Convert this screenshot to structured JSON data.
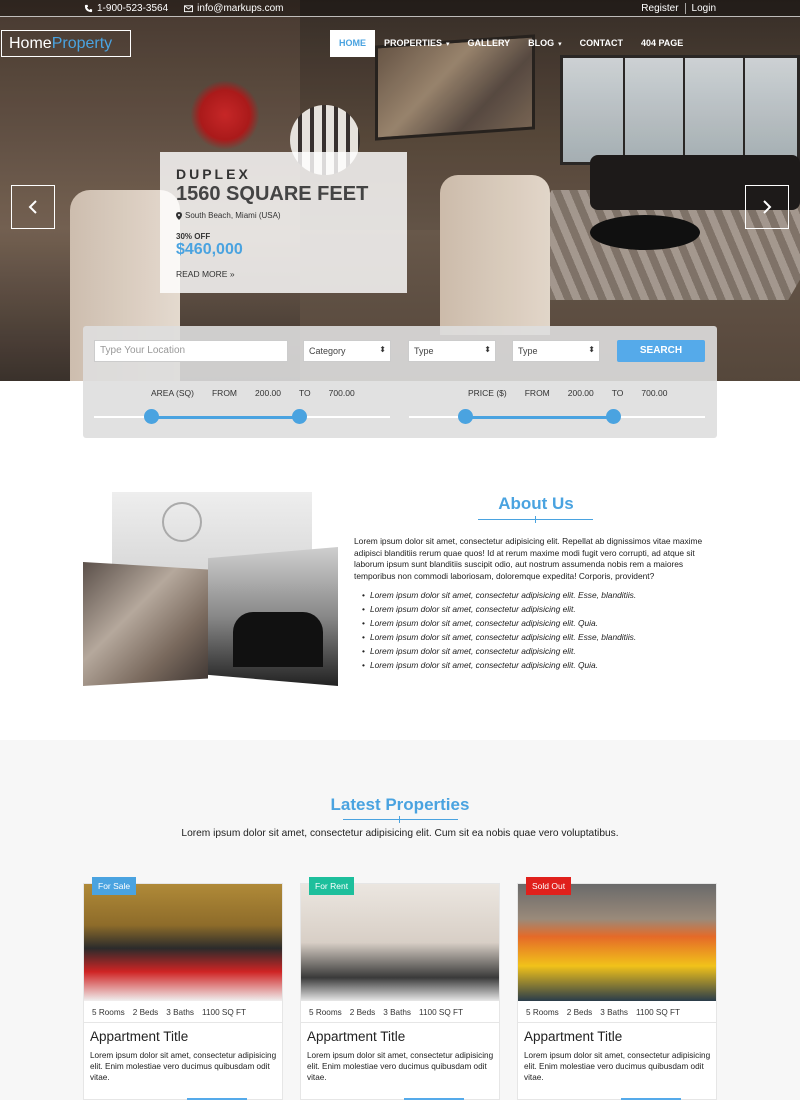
{
  "topbar": {
    "phone": "1-900-523-3564",
    "email": "info@markups.com",
    "register": "Register",
    "login": "Login"
  },
  "logo": {
    "part1": "Home",
    "part2": "Property"
  },
  "nav": {
    "items": [
      "HOME",
      "PROPERTIES",
      "GALLERY",
      "BLOG",
      "CONTACT",
      "404 PAGE"
    ]
  },
  "slide": {
    "type": "DUPLEX",
    "size": "1560 SQUARE FEET",
    "location": "South Beach, Miami (USA)",
    "discount": "30% OFF",
    "price": "$460,000",
    "more": "READ MORE"
  },
  "search": {
    "location_placeholder": "Type Your Location",
    "category": "Category",
    "type1": "Type",
    "type2": "Type",
    "button": "SEARCH",
    "area": {
      "label": "AREA (SQ)",
      "from_label": "FROM",
      "from": "200.00",
      "to_label": "TO",
      "to": "700.00"
    },
    "price": {
      "label": "PRICE ($)",
      "from_label": "FROM",
      "from": "200.00",
      "to_label": "TO",
      "to": "700.00"
    }
  },
  "about": {
    "title": "About Us",
    "text": "Lorem ipsum dolor sit amet, consectetur adipisicing elit. Repellat ab dignissimos vitae maxime adipisci blanditiis rerum quae quos! Id at rerum maxime modi fugit vero corrupti, ad atque sit laborum ipsum sunt blanditiis suscipit odio, aut nostrum assumenda nobis rem a maiores temporibus non commodi laboriosam, doloremque expedita! Corporis, provident?",
    "list": [
      "Lorem ipsum dolor sit amet, consectetur adipisicing elit. Esse, blanditiis.",
      "Lorem ipsum dolor sit amet, consectetur adipisicing elit.",
      "Lorem ipsum dolor sit amet, consectetur adipisicing elit. Quia.",
      "Lorem ipsum dolor sit amet, consectetur adipisicing elit. Esse, blanditiis.",
      "Lorem ipsum dolor sit amet, consectetur adipisicing elit.",
      "Lorem ipsum dolor sit amet, consectetur adipisicing elit. Quia."
    ]
  },
  "latest": {
    "title": "Latest Properties",
    "subtitle": "Lorem ipsum dolor sit amet, consectetur adipisicing elit. Cum sit ea nobis quae vero voluptatibus.",
    "cards": [
      {
        "tag": "For Sale",
        "tag_color": "#4aa3e0",
        "rooms": "5 Rooms",
        "beds": "2 Beds",
        "baths": "3 Baths",
        "area": "1100 SQ FT",
        "title": "Appartment Title",
        "desc": "Lorem ipsum dolor sit amet, consectetur adipisicing elit. Enim molestiae vero ducimus quibusdam odit vitae."
      },
      {
        "tag": "For Rent",
        "tag_color": "#1dbf9c",
        "rooms": "5 Rooms",
        "beds": "2 Beds",
        "baths": "3 Baths",
        "area": "1100 SQ FT",
        "title": "Appartment Title",
        "desc": "Lorem ipsum dolor sit amet, consectetur adipisicing elit. Enim molestiae vero ducimus quibusdam odit vitae."
      },
      {
        "tag": "Sold Out",
        "tag_color": "#e0201c",
        "rooms": "5 Rooms",
        "beds": "2 Beds",
        "baths": "3 Baths",
        "area": "1100 SQ FT",
        "title": "Appartment Title",
        "desc": "Lorem ipsum dolor sit amet, consectetur adipisicing elit. Enim molestiae vero ducimus quibusdam odit vitae."
      }
    ]
  },
  "colors": {
    "accent": "#4aa3e0",
    "button": "#55aaea"
  },
  "icons": [
    "phone-icon",
    "mail-icon",
    "map-marker-icon",
    "chevron-left-icon",
    "chevron-right-icon",
    "double-chevron-right-icon",
    "select-chevron-icon"
  ]
}
